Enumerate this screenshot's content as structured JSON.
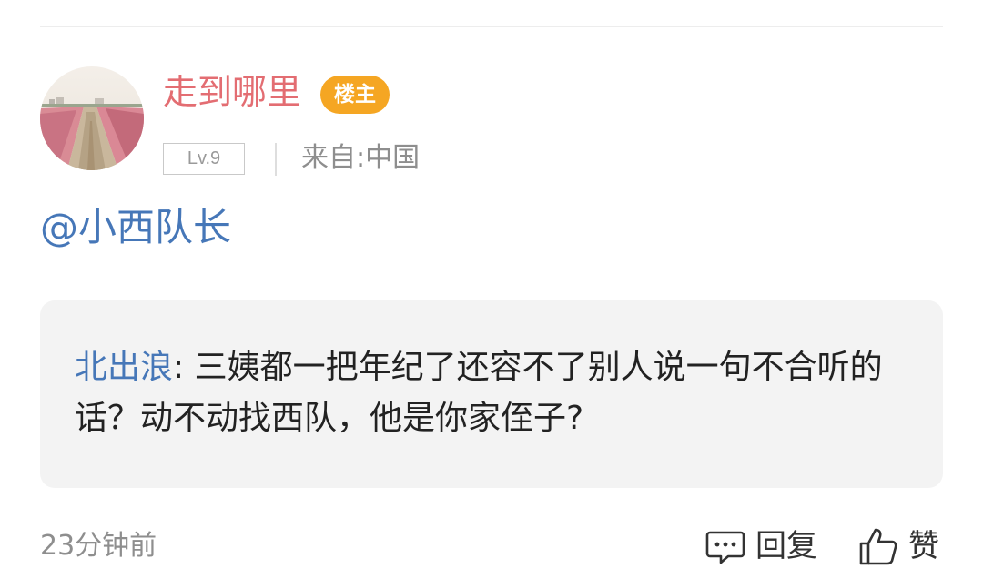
{
  "comment": {
    "author": {
      "name": "走到哪里",
      "op_badge": "楼主",
      "level": "Lv.9",
      "location": "来自:中国",
      "avatar_icon": "avatar-landscape-path-pink-grass"
    },
    "mention": "@小西队长",
    "quote": {
      "author": "北出浪",
      "separator": ": ",
      "text": "三姨都一把年纪了还容不了别人说一句不合听的话？动不动找西队，他是你家侄子?"
    },
    "timestamp": "23分钟前",
    "actions": {
      "reply_label": "回复",
      "reply_icon": "comment-bubble-icon",
      "like_label": "赞",
      "like_icon": "thumbs-up-icon"
    }
  },
  "colors": {
    "username": "#e36d72",
    "op_badge_bg": "#f5a623",
    "link_blue": "#4677b8",
    "muted_text": "#8e8e8e",
    "quote_bg": "#f3f3f3"
  }
}
